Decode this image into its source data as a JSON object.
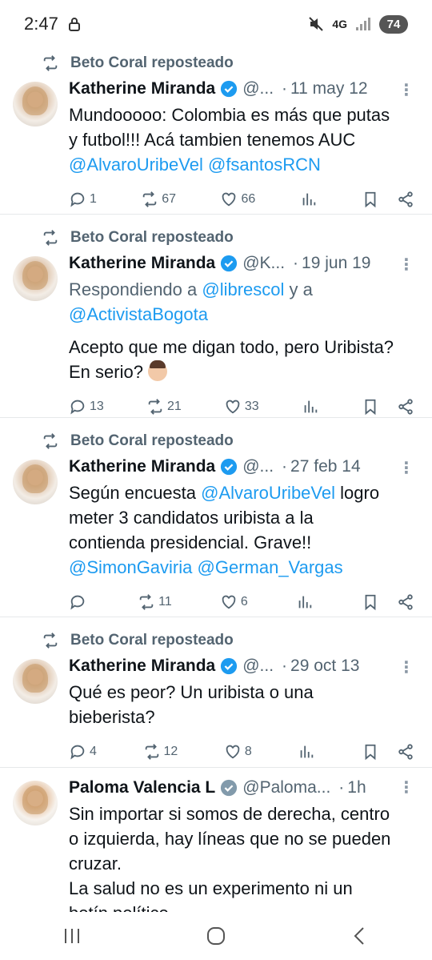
{
  "status": {
    "time": "2:47",
    "battery": "74",
    "network": "4G"
  },
  "tweets": [
    {
      "repost_by": "Beto Coral reposteado",
      "name": "Katherine Miranda",
      "handle": "@...",
      "time": "11 may 12",
      "text_line1": "Mundooooo: Colombia es más que putas",
      "text_line2": "y futbol!!! Acá tambien tenemos AUC",
      "mention1": "@AlvaroUribeVel",
      "mention2": "@fsantosRCN",
      "replies": "1",
      "reposts": "67",
      "likes": "66"
    },
    {
      "repost_by": "Beto Coral reposteado",
      "name": "Katherine Miranda",
      "handle": "@K...",
      "time": "19 jun 19",
      "replying_prefix": "Respondiendo a",
      "reply_to1": "@librescol",
      "reply_and": "y a",
      "reply_to2": "@ActivistaBogota",
      "text_line1": "Acepto que me digan todo, pero Uribista?",
      "text_line2": "En serio?",
      "replies": "13",
      "reposts": "21",
      "likes": "33"
    },
    {
      "repost_by": "Beto Coral reposteado",
      "name": "Katherine Miranda",
      "handle": "@...",
      "time": "27 feb 14",
      "text_pre": "Según encuesta",
      "mention_inline": "@AlvaroUribeVel",
      "text_post": "logro",
      "text_line2": "meter 3 candidatos uribista a la",
      "text_line3": "contienda presidencial. Grave!!",
      "mention1": "@SimonGaviria",
      "mention2": "@German_Vargas",
      "replies": "",
      "reposts": "11",
      "likes": "6"
    },
    {
      "repost_by": "Beto Coral reposteado",
      "name": "Katherine Miranda",
      "handle": "@...",
      "time": "29 oct 13",
      "text_line1": "Qué es peor? Un uribista o una",
      "text_line2": "bieberista?",
      "replies": "4",
      "reposts": "12",
      "likes": "8"
    },
    {
      "name": "Paloma Valencia L",
      "handle": "@Paloma...",
      "time": "1h",
      "text_line1": "Sin importar si somos de derecha, centro",
      "text_line2": "o izquierda, hay líneas que no se pueden",
      "text_line3": "cruzar.",
      "text_line4": "La salud no es un experimento ni un",
      "text_line5": "botín político."
    }
  ],
  "colors": {
    "link": "#1d9bf0",
    "muted": "#536471",
    "verified_blue": "#1d9bf0",
    "verified_gray": "#829aab"
  }
}
